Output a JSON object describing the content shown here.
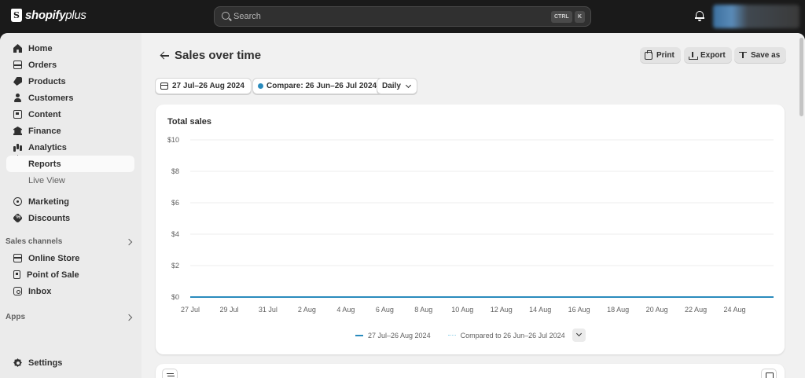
{
  "topbar": {
    "brand": "shopify",
    "brand_suffix": "plus",
    "search_placeholder": "Search",
    "shortcut_mod": "CTRL",
    "shortcut_key": "K"
  },
  "sidebar": {
    "items": [
      {
        "label": "Home",
        "icon": "home-icon"
      },
      {
        "label": "Orders",
        "icon": "inbox-tray-icon"
      },
      {
        "label": "Products",
        "icon": "tag-icon"
      },
      {
        "label": "Customers",
        "icon": "person-icon"
      },
      {
        "label": "Content",
        "icon": "content-icon"
      },
      {
        "label": "Finance",
        "icon": "bank-icon"
      },
      {
        "label": "Analytics",
        "icon": "bar-chart-icon"
      },
      {
        "label": "Reports"
      },
      {
        "label": "Live View"
      },
      {
        "label": "Marketing",
        "icon": "target-icon"
      },
      {
        "label": "Discounts",
        "icon": "discount-icon"
      }
    ],
    "sales_channels_label": "Sales channels",
    "channels": [
      {
        "label": "Online Store",
        "icon": "store-icon"
      },
      {
        "label": "Point of Sale",
        "icon": "pos-icon"
      },
      {
        "label": "Inbox",
        "icon": "chat-icon"
      }
    ],
    "apps_label": "Apps",
    "settings_label": "Settings"
  },
  "header": {
    "title": "Sales over time",
    "print_label": "Print",
    "export_label": "Export",
    "save_as_label": "Save as"
  },
  "filters": {
    "date_range": "27 Jul–26 Aug 2024",
    "compare": "Compare: 26 Jun–26 Jul 2024",
    "granularity": "Daily"
  },
  "chart_card": {
    "title": "Total sales"
  },
  "chart_data": {
    "type": "line",
    "title": "Total sales",
    "x": [
      "27 Jul",
      "29 Jul",
      "31 Jul",
      "2 Aug",
      "4 Aug",
      "6 Aug",
      "8 Aug",
      "10 Aug",
      "12 Aug",
      "14 Aug",
      "16 Aug",
      "18 Aug",
      "20 Aug",
      "22 Aug",
      "24 Aug"
    ],
    "y_ticks": [
      "$0",
      "$2",
      "$4",
      "$6",
      "$8",
      "$10"
    ],
    "ylim": [
      0,
      10
    ],
    "series": [
      {
        "name": "27 Jul–26 Aug 2024",
        "color": "#2a8bbd",
        "style": "solid",
        "values": [
          0,
          0,
          0,
          0,
          0,
          0,
          0,
          0,
          0,
          0,
          0,
          0,
          0,
          0,
          0,
          0,
          0,
          0,
          0,
          0,
          0,
          0,
          0,
          0,
          0,
          0,
          0,
          0,
          0,
          0,
          0
        ]
      },
      {
        "name": "Compared to 26 Jun–26 Jul 2024",
        "color": "#8fd0e8",
        "style": "dotted",
        "values": [
          0,
          0,
          0,
          0,
          0,
          0,
          0,
          0,
          0,
          0,
          0,
          0,
          0,
          0,
          0,
          0,
          0,
          0,
          0,
          0,
          0,
          0,
          0,
          0,
          0,
          0,
          0,
          0,
          0,
          0,
          0
        ]
      }
    ],
    "grid": true,
    "legend_position": "bottom-center"
  }
}
